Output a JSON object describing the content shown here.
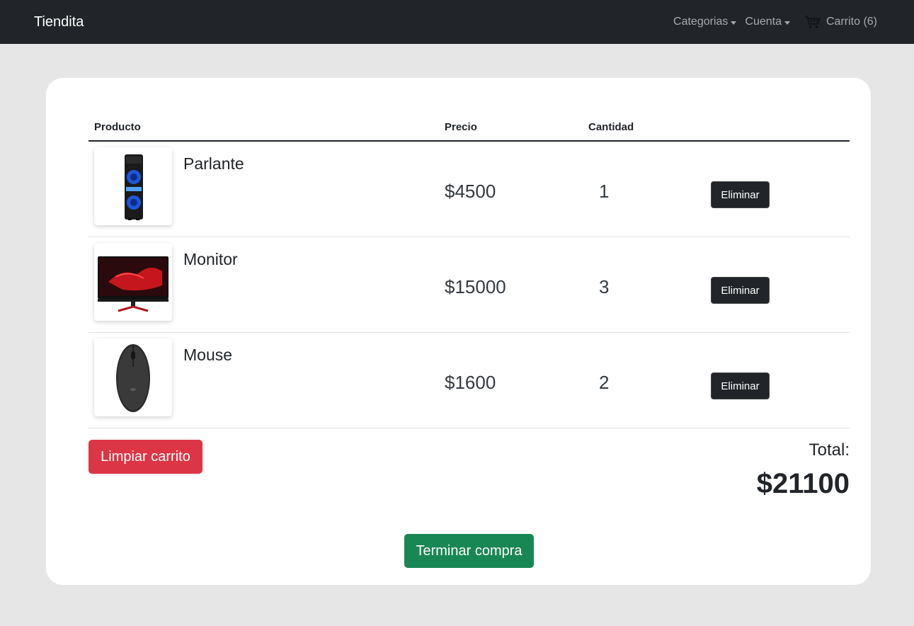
{
  "navbar": {
    "brand": "Tiendita",
    "categories_label": "Categorias",
    "account_label": "Cuenta",
    "cart_label": "Carrito (6)"
  },
  "table": {
    "headers": {
      "product": "Producto",
      "price": "Precio",
      "quantity": "Cantidad"
    },
    "rows": [
      {
        "name": "Parlante",
        "price": "$4500",
        "quantity": "1",
        "action": "Eliminar",
        "image": "speaker-image"
      },
      {
        "name": "Monitor",
        "price": "$15000",
        "quantity": "3",
        "action": "Eliminar",
        "image": "monitor-image"
      },
      {
        "name": "Mouse",
        "price": "$1600",
        "quantity": "2",
        "action": "Eliminar",
        "image": "mouse-image"
      }
    ]
  },
  "actions": {
    "clear_label": "Limpiar carrito",
    "finish_label": "Terminar compra"
  },
  "total": {
    "label": "Total:",
    "value": "$21100"
  },
  "colors": {
    "navbar_bg": "#212529",
    "page_bg": "#e6e6e6",
    "danger": "#dc3545",
    "success": "#198754",
    "dark_button": "#212529"
  }
}
